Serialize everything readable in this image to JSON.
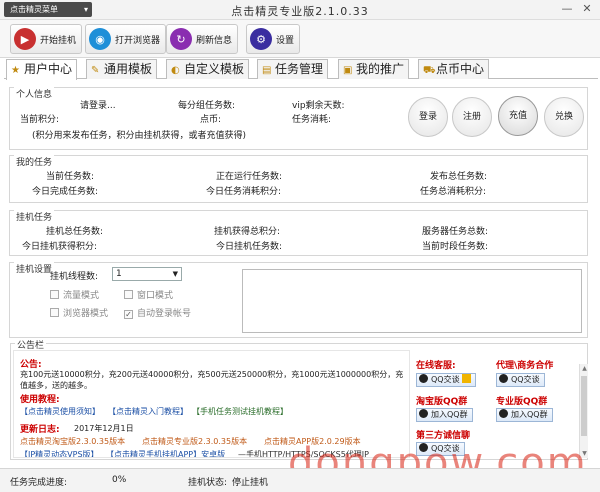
{
  "titlebar": {
    "menu_label": "点击精灵菜单",
    "menu_caret": "▾",
    "title": "点击精灵专业版2.1.0.33",
    "minimize": "—",
    "close": "✕"
  },
  "toolbar": {
    "start_label": "开始挂机",
    "browser_label": "打开浏览器",
    "refresh_label": "刷新信息",
    "settings_label": "设置"
  },
  "tabs": [
    {
      "label": "用户中心",
      "icon": "★"
    },
    {
      "label": "通用模板",
      "icon": "✎"
    },
    {
      "label": "自定义模板",
      "icon": "◐"
    },
    {
      "label": "任务管理",
      "icon": "▤"
    },
    {
      "label": "我的推广",
      "icon": "▣"
    },
    {
      "label": "点币中心",
      "icon": "⛟"
    }
  ],
  "personal": {
    "title": "个人信息",
    "login_prompt": "请登录...",
    "daily_tasks_label": "每分组任务数:",
    "vip_days_label": "vip剩余天数:",
    "current_points_label": "当前积分:",
    "coins_label": "点币:",
    "task_consume_label": "任务消耗:",
    "hint": "(积分用来发布任务，积分由挂机获得，或者充值获得)",
    "buttons": {
      "login": "登录",
      "register": "注册",
      "recharge": "充值",
      "exchange": "兑换"
    }
  },
  "my_tasks": {
    "title": "我的任务",
    "current_tasks": "当前任务数:",
    "running_tasks": "正在运行任务数:",
    "published_total": "发布总任务数:",
    "today_completed": "今日完成任务数:",
    "today_consumed_points": "今日任务消耗积分:",
    "total_consumed_points": "任务总消耗积分:"
  },
  "hang_tasks": {
    "title": "挂机任务",
    "hang_total": "挂机总任务数:",
    "hang_total_points": "挂机获得总积分:",
    "server_tasks": "服务器任务总数:",
    "today_points": "今日挂机获得积分:",
    "today_hang_tasks": "今日挂机任务数:",
    "current_period": "当前时段任务数:"
  },
  "hang_settings": {
    "title": "挂机设置",
    "threads_label": "挂机线程数:",
    "threads_value": "1",
    "opt_traffic": "流量模式",
    "opt_window": "窗口模式",
    "opt_browser": "浏览器模式",
    "opt_autologin": "自动登录帐号",
    "check_mark": "✓"
  },
  "notice": {
    "title": "公告栏",
    "announce_head": "公告:",
    "announce_text": "充100元送10000积分，充200元送40000积分，充500元送250000积分，充1000元送1000000积分，充值越多，送的越多。",
    "tutorial_head": "使用教程:",
    "tutorial_links": [
      "【点击精灵使用须知】",
      "【点击精灵入门教程】",
      "【手机任务测试挂机教程】"
    ],
    "log_head": "更新日志:",
    "log_date": "2017年12月1日",
    "log_links": [
      "点击精灵淘宝版2.3.0.35版本",
      "点击精灵专业版2.3.0.35版本",
      "点击精灵APP版2.0.29版本"
    ],
    "bottom_links": [
      "【IP精灵动态VPS版】",
      "【点击精灵手机挂机APP】安卓版"
    ],
    "bottom_text": "—手机HTTP/HTTPS/SOCKS5代理IP"
  },
  "contacts": {
    "online_service": "在线客服:",
    "agent_coop": "代理\\商务合作",
    "qq_talk": "QQ交谈",
    "taobao_group": "淘宝版QQ群",
    "pro_group": "专业版QQ群",
    "join_group": "加入QQ群",
    "third_party_wechat": "第三方诚信聊"
  },
  "status": {
    "progress_label": "任务完成进度:",
    "progress_value": "0%",
    "hang_state_label": "挂机状态:",
    "hang_state_value": "停止挂机"
  },
  "watermark": "dongpow.com",
  "colors": {
    "accent_red": "#cc0000",
    "link_green": "#2a6d2a",
    "link_blue": "#1b4fa5"
  }
}
